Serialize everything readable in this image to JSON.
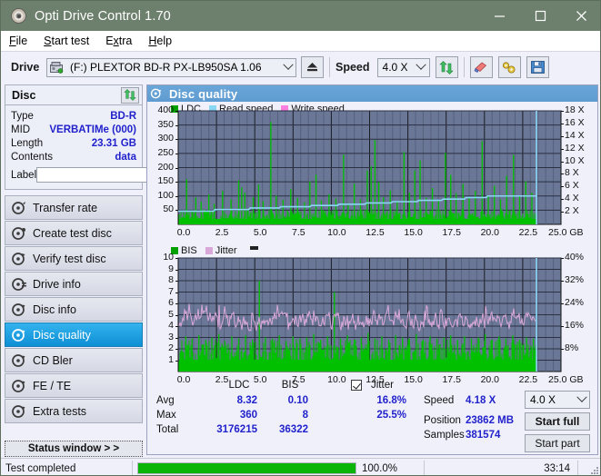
{
  "window": {
    "title": "Opti Drive Control 1.70",
    "icon": "disc-icon",
    "minimize": "minimize",
    "maximize": "maximize",
    "close": "close"
  },
  "menu": [
    {
      "label": "File",
      "accel": "F"
    },
    {
      "label": "Start test",
      "accel": "S"
    },
    {
      "label": "Extra",
      "accel": "x"
    },
    {
      "label": "Help",
      "accel": "H"
    }
  ],
  "toolbar": {
    "drive_label": "Drive",
    "drive_value": "(F:)   PLEXTOR BD-R  PX-LB950SA 1.06",
    "eject_icon": "eject-icon",
    "speed_label": "Speed",
    "speed_value": "4.0 X",
    "refresh_icon": "refresh-icon",
    "erase_icon": "eraser-icon",
    "tools_icon": "tools-icon",
    "save_icon": "save-icon"
  },
  "disc": {
    "header": "Disc",
    "refresh_icon": "refresh-icon",
    "rows": [
      {
        "key": "Type",
        "value": "BD-R"
      },
      {
        "key": "MID",
        "value": "VERBATIMe (000)"
      },
      {
        "key": "Length",
        "value": "23.31 GB"
      },
      {
        "key": "Contents",
        "value": "data"
      }
    ],
    "label_key": "Label",
    "label_value": "",
    "label_placeholder": "",
    "disc_icon": "cd-icon"
  },
  "nav": {
    "items": [
      {
        "label": "Transfer rate",
        "icon": "disc-test-icon",
        "selected": false
      },
      {
        "label": "Create test disc",
        "icon": "disc-burn-icon",
        "selected": false
      },
      {
        "label": "Verify test disc",
        "icon": "disc-verify-icon",
        "selected": false
      },
      {
        "label": "Drive info",
        "icon": "disc-info-icon",
        "selected": false
      },
      {
        "label": "Disc info",
        "icon": "disc-detail-icon",
        "selected": false
      },
      {
        "label": "Disc quality",
        "icon": "disc-quality-icon",
        "selected": true
      },
      {
        "label": "CD Bler",
        "icon": "disc-bler-icon",
        "selected": false
      },
      {
        "label": "FE / TE",
        "icon": "disc-fete-icon",
        "selected": false
      },
      {
        "label": "Extra tests",
        "icon": "disc-extra-icon",
        "selected": false
      }
    ],
    "status_window": "Status window > >"
  },
  "main": {
    "title": "Disc quality",
    "title_icon": "disc-quality-icon"
  },
  "stats": {
    "col_ldc": "LDC",
    "col_bis": "BIS",
    "jitter_label": "Jitter",
    "jitter_checked": true,
    "rows": [
      {
        "name": "Avg",
        "ldc": "8.32",
        "bis": "0.10",
        "jitter": "16.8%"
      },
      {
        "name": "Max",
        "ldc": "360",
        "bis": "8",
        "jitter": "25.5%"
      },
      {
        "name": "Total",
        "ldc": "3176215",
        "bis": "36322",
        "jitter": ""
      }
    ],
    "speed_label": "Speed",
    "speed_value": "4.18 X",
    "speed_select": "4.0 X",
    "position_label": "Position",
    "position_value": "23862 MB",
    "samples_label": "Samples",
    "samples_value": "381574",
    "start_full": "Start full",
    "start_part": "Start part"
  },
  "statusbar": {
    "message": "Test completed",
    "percent": "100.0%",
    "progress": 100,
    "elapsed": "33:14"
  },
  "colors": {
    "ldc": "#00c000",
    "bis": "#00c000",
    "read_speed": "#8ad6f5",
    "write_speed": "#ff7fe0",
    "jitter": "#d9a8d9",
    "plot_bg": "#6a7796",
    "grid": "#4d5775",
    "accent": "#2222cc",
    "title_bar": "#6d806d",
    "selection": "#18a0e0",
    "progress": "#09b509"
  },
  "chart_data": [
    {
      "type": "line",
      "name": "top-chart-ldc",
      "title": "LDC / Read speed / Write speed",
      "legend": [
        {
          "label": "LDC",
          "color": "#00c000"
        },
        {
          "label": "Read speed",
          "color": "#8ad6f5"
        },
        {
          "label": "Write speed",
          "color": "#ff7fe0"
        }
      ],
      "legend_position": "top-left",
      "grid": true,
      "xlabel": "GB",
      "x_ticks": [
        "0.0",
        "2.5",
        "5.0",
        "7.5",
        "10.0",
        "12.5",
        "15.0",
        "17.5",
        "20.0",
        "22.5",
        "25.0 GB"
      ],
      "xlim": [
        0,
        25
      ],
      "ylabel_left": "LDC",
      "y_ticks_left": [
        50,
        100,
        150,
        200,
        250,
        300,
        350,
        400
      ],
      "ylim_left": [
        0,
        400
      ],
      "ylabel_right": "Speed",
      "y_ticks_right": [
        "2 X",
        "4 X",
        "6 X",
        "8 X",
        "10 X",
        "12 X",
        "14 X",
        "16 X",
        "18 X"
      ],
      "ylim_right": [
        0,
        18
      ],
      "series": [
        {
          "name": "LDC",
          "color": "#00c000",
          "style": "spikes",
          "baseline": 35,
          "data_end_gb": 23.4,
          "spikes": [
            [
              0.55,
              160
            ],
            [
              1.15,
              95
            ],
            [
              1.5,
              80
            ],
            [
              2.0,
              105
            ],
            [
              2.35,
              72
            ],
            [
              2.9,
              118
            ],
            [
              3.45,
              88
            ],
            [
              3.95,
              155
            ],
            [
              4.15,
              130
            ],
            [
              4.35,
              112
            ],
            [
              4.9,
              96
            ],
            [
              5.25,
              140
            ],
            [
              5.55,
              82
            ],
            [
              6.05,
              360
            ],
            [
              6.4,
              101
            ],
            [
              6.85,
              87
            ],
            [
              7.35,
              124
            ],
            [
              7.8,
              93
            ],
            [
              8.25,
              78
            ],
            [
              8.6,
              152
            ],
            [
              9.0,
              175
            ],
            [
              9.35,
              84
            ],
            [
              9.85,
              106
            ],
            [
              10.3,
              91
            ],
            [
              10.8,
              246
            ],
            [
              11.1,
              75
            ],
            [
              11.5,
              143
            ],
            [
              11.9,
              88
            ],
            [
              12.35,
              190
            ],
            [
              12.6,
              205
            ],
            [
              12.85,
              297
            ],
            [
              13.1,
              149
            ],
            [
              13.4,
              96
            ],
            [
              13.85,
              120
            ],
            [
              14.3,
              83
            ],
            [
              14.75,
              255
            ],
            [
              15.1,
              112
            ],
            [
              15.45,
              190
            ],
            [
              15.8,
              225
            ],
            [
              16.2,
              94
            ],
            [
              16.6,
              128
            ],
            [
              17.0,
              86
            ],
            [
              17.45,
              252
            ],
            [
              17.8,
              174
            ],
            [
              18.15,
              110
            ],
            [
              18.6,
              142
            ],
            [
              19.0,
              95
            ],
            [
              19.4,
              118
            ],
            [
              19.85,
              293
            ],
            [
              20.25,
              101
            ],
            [
              20.65,
              136
            ],
            [
              21.05,
              88
            ],
            [
              21.45,
              171
            ],
            [
              21.9,
              245
            ],
            [
              22.3,
              99
            ],
            [
              22.7,
              152
            ],
            [
              23.1,
              112
            ]
          ]
        },
        {
          "name": "Read speed",
          "color": "#8ad6f5",
          "style": "steps",
          "points": [
            [
              0.0,
              2.1
            ],
            [
              2.3,
              2.1
            ],
            [
              2.4,
              2.35
            ],
            [
              4.6,
              2.35
            ],
            [
              4.7,
              2.6
            ],
            [
              6.6,
              2.6
            ],
            [
              6.7,
              2.8
            ],
            [
              8.6,
              2.8
            ],
            [
              8.7,
              3.0
            ],
            [
              10.4,
              3.0
            ],
            [
              10.5,
              3.2
            ],
            [
              12.2,
              3.2
            ],
            [
              12.3,
              3.4
            ],
            [
              13.9,
              3.4
            ],
            [
              14.0,
              3.6
            ],
            [
              15.6,
              3.6
            ],
            [
              15.7,
              3.8
            ],
            [
              17.2,
              3.8
            ],
            [
              17.3,
              4.0
            ],
            [
              18.7,
              4.0
            ],
            [
              18.8,
              4.25
            ],
            [
              20.1,
              4.25
            ],
            [
              20.2,
              4.5
            ],
            [
              23.4,
              4.5
            ]
          ]
        },
        {
          "name": "Write speed",
          "color": "#ff7fe0",
          "style": "none",
          "points": []
        }
      ],
      "markers": [
        {
          "type": "vline",
          "x": 23.4,
          "color": "#8ad6f5",
          "label": "end-of-data"
        }
      ]
    },
    {
      "type": "line",
      "name": "bottom-chart-bis",
      "title": "BIS / Jitter",
      "legend": [
        {
          "label": "BIS",
          "color": "#00c000"
        },
        {
          "label": "Jitter",
          "color": "#d9a8d9"
        }
      ],
      "legend_position": "top-left",
      "grid": true,
      "xlabel": "GB",
      "x_ticks": [
        "0.0",
        "2.5",
        "5.0",
        "7.5",
        "10.0",
        "12.5",
        "15.0",
        "17.5",
        "20.0",
        "22.5",
        "25.0 GB"
      ],
      "xlim": [
        0,
        25
      ],
      "ylabel_left": "BIS",
      "y_ticks_left": [
        1,
        2,
        3,
        4,
        5,
        6,
        7,
        8,
        9,
        10
      ],
      "ylim_left": [
        0,
        10
      ],
      "ylabel_right": "Jitter",
      "y_ticks_right": [
        "8%",
        "16%",
        "24%",
        "32%",
        "40%"
      ],
      "ylim_right": [
        0,
        40
      ],
      "series": [
        {
          "name": "BIS",
          "color": "#00c000",
          "style": "filled-spikes",
          "baseline": 1.9,
          "data_end_gb": 23.4,
          "spikes": [
            [
              0.5,
              3.1
            ],
            [
              0.9,
              2.9
            ],
            [
              1.35,
              3.2
            ],
            [
              1.8,
              2.8
            ],
            [
              2.2,
              3.0
            ],
            [
              2.65,
              3.3
            ],
            [
              3.05,
              2.7
            ],
            [
              3.5,
              3.1
            ],
            [
              3.95,
              2.9
            ],
            [
              4.4,
              3.2
            ],
            [
              4.85,
              2.8
            ],
            [
              5.3,
              8.0
            ],
            [
              5.7,
              3.0
            ],
            [
              6.15,
              2.9
            ],
            [
              6.6,
              3.2
            ],
            [
              7.05,
              2.7
            ],
            [
              7.5,
              3.1
            ],
            [
              7.95,
              2.9
            ],
            [
              8.4,
              3.0
            ],
            [
              8.85,
              3.3
            ],
            [
              9.3,
              2.8
            ],
            [
              9.75,
              3.1
            ],
            [
              10.2,
              7.0
            ],
            [
              10.6,
              2.9
            ],
            [
              11.05,
              3.2
            ],
            [
              11.5,
              2.8
            ],
            [
              11.95,
              3.0
            ],
            [
              12.4,
              3.4
            ],
            [
              12.85,
              2.9
            ],
            [
              13.3,
              3.1
            ],
            [
              13.75,
              2.8
            ],
            [
              14.2,
              3.2
            ],
            [
              14.65,
              3.0
            ],
            [
              15.1,
              2.9
            ],
            [
              15.55,
              3.3
            ],
            [
              16.0,
              2.8
            ],
            [
              16.45,
              3.1
            ],
            [
              16.9,
              2.9
            ],
            [
              17.35,
              3.0
            ],
            [
              17.8,
              3.2
            ],
            [
              18.25,
              2.8
            ],
            [
              18.7,
              3.1
            ],
            [
              19.15,
              2.9
            ],
            [
              19.6,
              3.0
            ],
            [
              20.05,
              3.3
            ],
            [
              20.5,
              2.8
            ],
            [
              20.95,
              3.1
            ],
            [
              21.4,
              2.9
            ],
            [
              21.85,
              3.2
            ],
            [
              22.3,
              2.8
            ],
            [
              22.75,
              3.0
            ],
            [
              23.2,
              2.9
            ]
          ]
        },
        {
          "name": "Jitter",
          "color": "#d9a8d9",
          "style": "noise",
          "mean": 4.5,
          "min": 3.6,
          "max": 6.4,
          "data_end_gb": 23.4
        }
      ],
      "markers": [
        {
          "type": "vline",
          "x": 23.4,
          "color": "#8ad6f5",
          "label": "end-of-data"
        }
      ]
    }
  ]
}
